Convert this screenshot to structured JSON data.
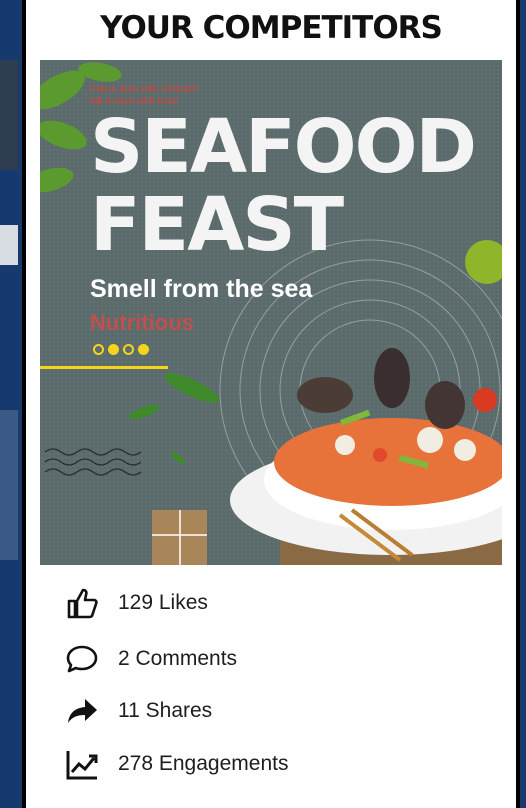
{
  "header": {
    "title": "YOUR COMPETITORS"
  },
  "poster": {
    "tagline_1": "Fall in love with Vietnam",
    "tagline_2": "fall in love with food",
    "headline_1": "SEAFOOD",
    "headline_2": "FEAST",
    "subtitle": "Smell from the sea",
    "accent_word": "Nutritious",
    "carousel_dots": [
      false,
      true,
      false,
      true
    ]
  },
  "stats": {
    "likes": "129 Likes",
    "comments": "2 Comments",
    "shares": "11 Shares",
    "engagements": "278 Engagements"
  },
  "colors": {
    "poster_bg": "#5b6a6b",
    "accent_yellow": "#f5d51c",
    "accent_red": "#c0504d"
  }
}
